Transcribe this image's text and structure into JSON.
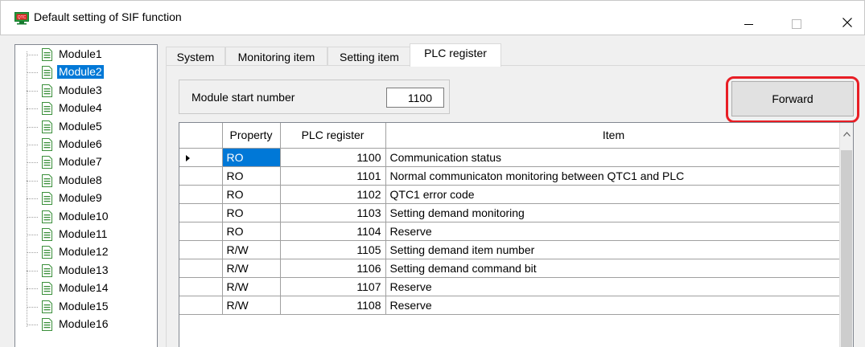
{
  "window": {
    "title": "Default setting of SIF function",
    "app_icon": "qtc-app-icon",
    "accent": "#0078d7",
    "highlight": "#e81e25"
  },
  "tree": {
    "items": [
      {
        "label": "Module1"
      },
      {
        "label": "Module2",
        "selected": true
      },
      {
        "label": "Module3"
      },
      {
        "label": "Module4"
      },
      {
        "label": "Module5"
      },
      {
        "label": "Module6"
      },
      {
        "label": "Module7"
      },
      {
        "label": "Module8"
      },
      {
        "label": "Module9"
      },
      {
        "label": "Module10"
      },
      {
        "label": "Module11"
      },
      {
        "label": "Module12"
      },
      {
        "label": "Module13"
      },
      {
        "label": "Module14"
      },
      {
        "label": "Module15"
      },
      {
        "label": "Module16"
      }
    ]
  },
  "tabs": [
    {
      "label": "System"
    },
    {
      "label": "Monitoring item"
    },
    {
      "label": "Setting item"
    },
    {
      "label": "PLC register",
      "active": true
    }
  ],
  "module_start": {
    "label": "Module start number",
    "value": "1100"
  },
  "forward_button": {
    "label": "Forward"
  },
  "grid": {
    "headers": [
      "Property",
      "PLC register",
      "Item"
    ],
    "rows": [
      {
        "property": "RO",
        "register": "1100",
        "item": "Communication status",
        "current": true
      },
      {
        "property": "RO",
        "register": "1101",
        "item": "Normal communicaton monitoring between QTC1 and PLC"
      },
      {
        "property": "RO",
        "register": "1102",
        "item": "QTC1 error code"
      },
      {
        "property": "RO",
        "register": "1103",
        "item": "Setting demand monitoring"
      },
      {
        "property": "RO",
        "register": "1104",
        "item": "Reserve"
      },
      {
        "property": "R/W",
        "register": "1105",
        "item": "Setting demand item number"
      },
      {
        "property": "R/W",
        "register": "1106",
        "item": "Setting demand command bit"
      },
      {
        "property": "R/W",
        "register": "1107",
        "item": "Reserve"
      },
      {
        "property": "R/W",
        "register": "1108",
        "item": "Reserve"
      }
    ]
  }
}
